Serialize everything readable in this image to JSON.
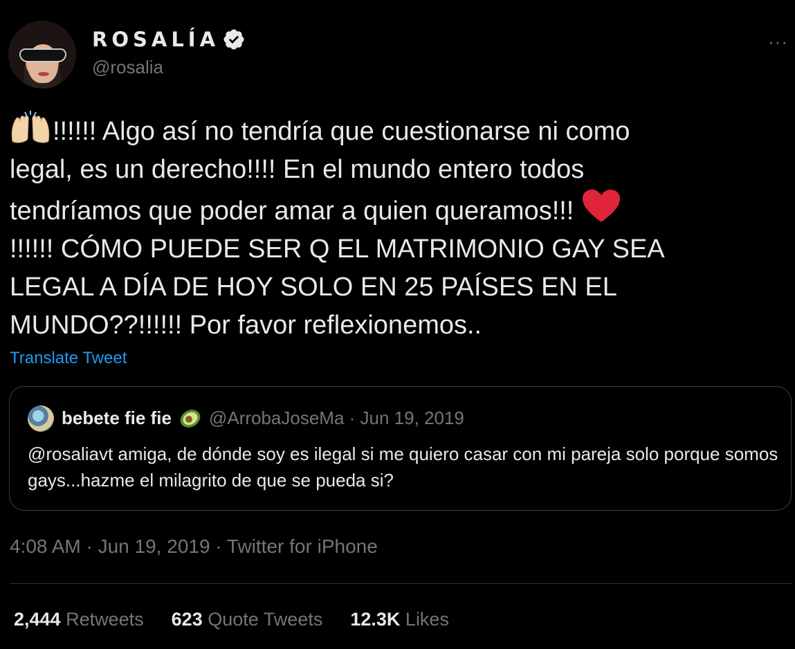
{
  "author": {
    "display_name": "ROSALÍA",
    "handle": "@rosalia"
  },
  "more_label": "···",
  "tweet": {
    "line1": "!!!!!! Algo así no tendría que cuestionarse ni como",
    "line2": "legal, es un derecho!!!! En el mundo entero todos",
    "line3": "tendríamos que poder amar a quien queramos!!! ",
    "line4": "!!!!!! CÓMO PUEDE SER Q EL MATRIMONIO GAY SEA",
    "line5": "LEGAL A DÍA DE HOY SOLO EN 25 PAÍSES EN EL",
    "line6": "MUNDO??!!!!!! Por favor reflexionemos..",
    "translate_label": "Translate Tweet"
  },
  "quote": {
    "name": "bebete fie fie",
    "handle_date": "@ArrobaJoseMa · Jun 19, 2019",
    "text": "@rosaliavt amiga, de dónde soy es ilegal si me quiero casar con mi pareja solo porque somos gays...hazme el milagrito de que se pueda si?"
  },
  "meta": "4:08 AM · Jun 19, 2019 · Twitter for iPhone",
  "stats": {
    "retweets_count": "2,444",
    "retweets_label": "Retweets",
    "quotes_count": "623",
    "quotes_label": "Quote Tweets",
    "likes_count": "12.3K",
    "likes_label": "Likes"
  },
  "colors": {
    "background": "#000000",
    "text": "#e7e9ea",
    "secondary": "#71767b",
    "link": "#1d9bf0",
    "border": "#2f3336"
  },
  "icons": {
    "verified": "verified-badge-icon",
    "raised_hands": "raised-hands-emoji-icon",
    "heart": "red-heart-emoji-icon",
    "avocado": "avocado-emoji-icon",
    "more": "more-options-icon"
  }
}
